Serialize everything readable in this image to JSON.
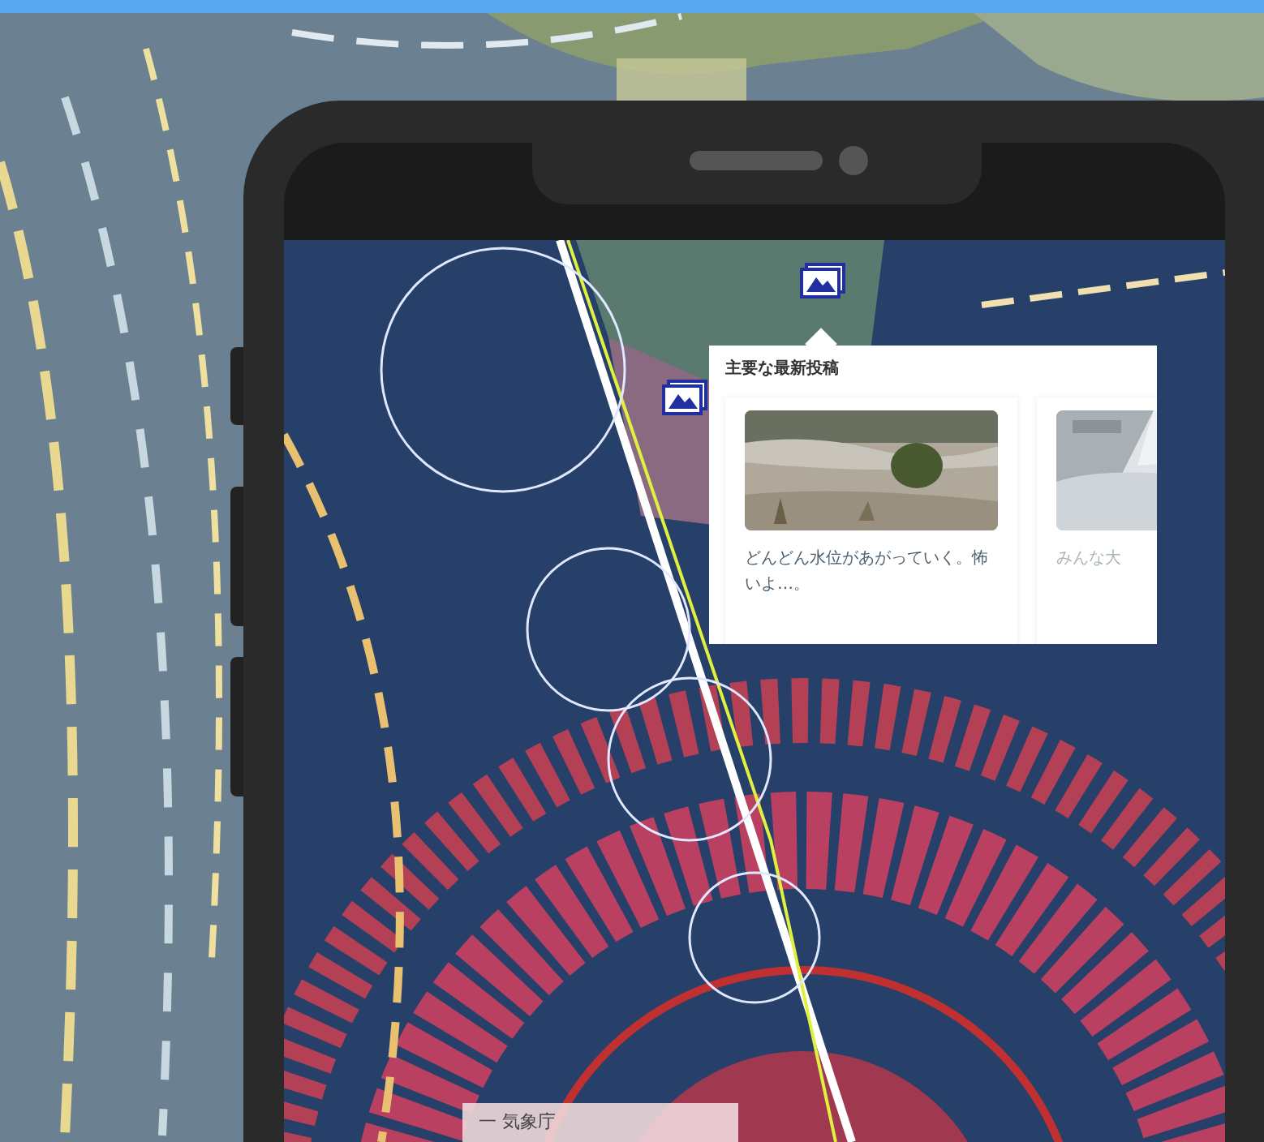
{
  "popup": {
    "title": "主要な最新投稿",
    "posts": [
      {
        "kind": "picture",
        "text": "どんどん水位があがっていく。怖いよ…。"
      },
      {
        "kind": "picture",
        "text": "みんな大"
      }
    ]
  },
  "source_label": "一 気象庁"
}
